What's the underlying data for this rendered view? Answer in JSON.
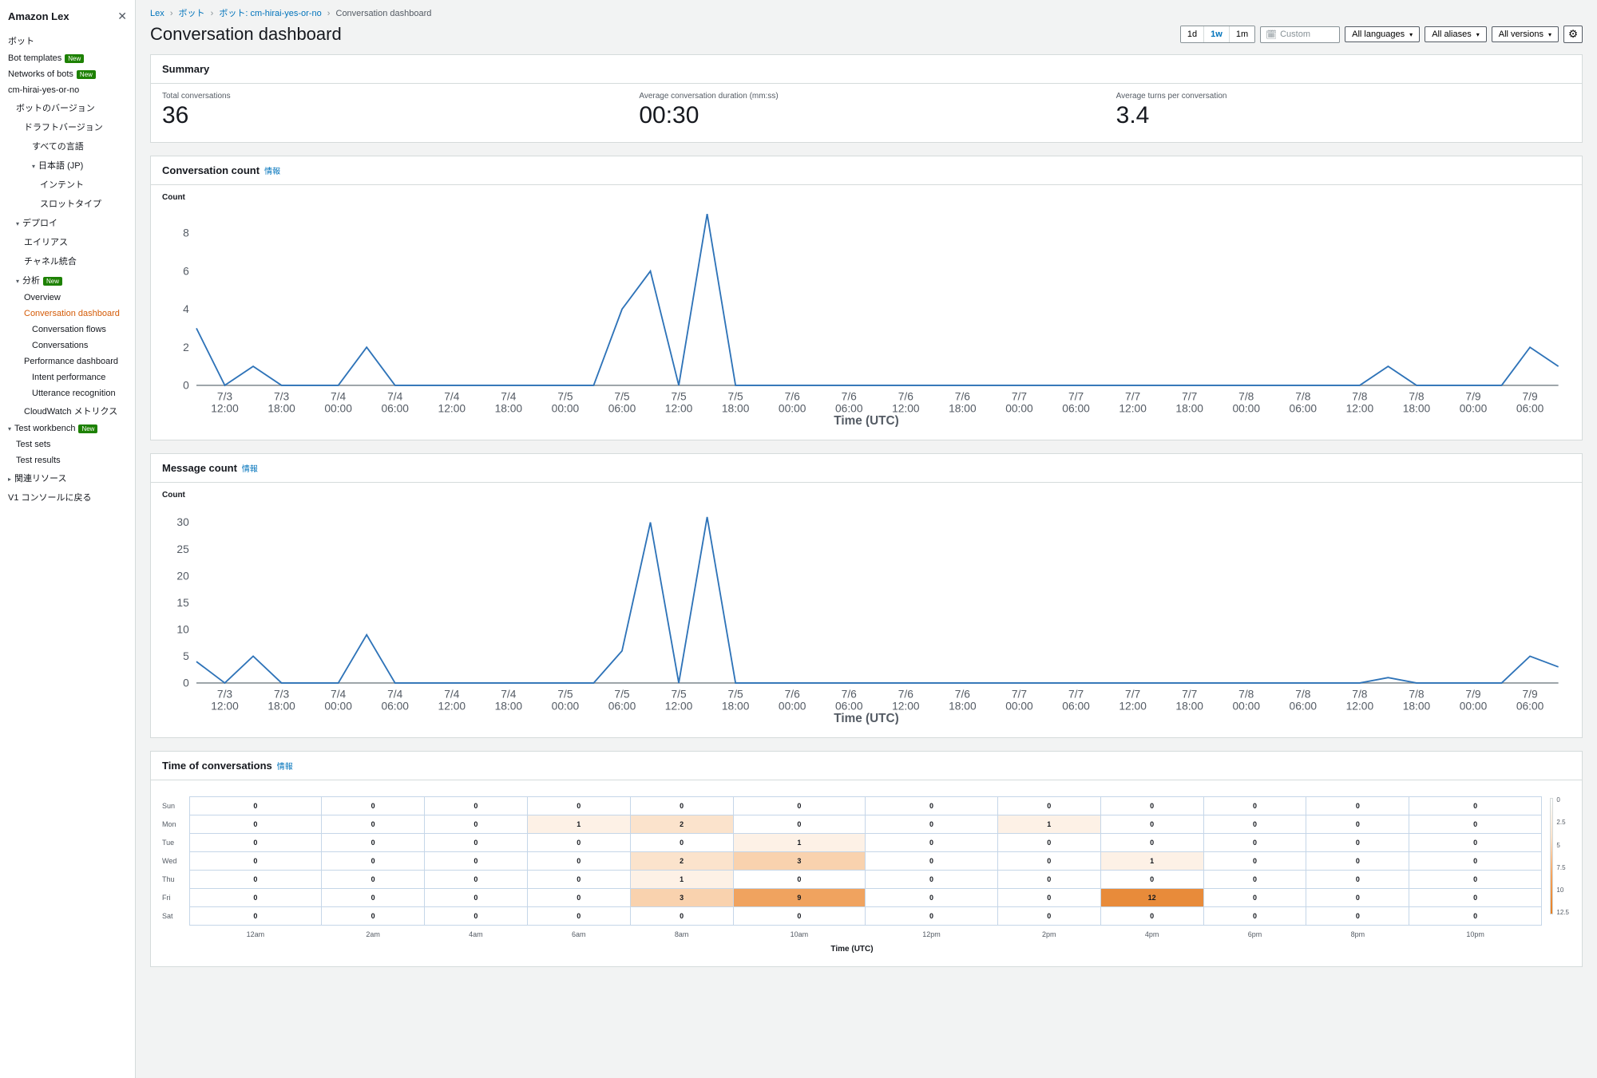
{
  "sidebar": {
    "title": "Amazon Lex",
    "items": [
      {
        "label": "ボット",
        "indent": 0,
        "caret": "",
        "badge": ""
      },
      {
        "label": "Bot templates",
        "indent": 0,
        "caret": "",
        "badge": "New"
      },
      {
        "label": "Networks of bots",
        "indent": 0,
        "caret": "",
        "badge": "New"
      },
      {
        "label": "cm-hirai-yes-or-no",
        "indent": 0,
        "caret": "",
        "badge": ""
      },
      {
        "label": "ボットのバージョン",
        "indent": 1,
        "caret": "",
        "badge": ""
      },
      {
        "label": "ドラフトバージョン",
        "indent": 2,
        "caret": "",
        "badge": ""
      },
      {
        "label": "すべての言語",
        "indent": 3,
        "caret": "",
        "badge": ""
      },
      {
        "label": "日本語 (JP)",
        "indent": 3,
        "caret": "down",
        "badge": ""
      },
      {
        "label": "インテント",
        "indent": 4,
        "caret": "",
        "badge": ""
      },
      {
        "label": "スロットタイプ",
        "indent": 4,
        "caret": "",
        "badge": ""
      },
      {
        "label": "デプロイ",
        "indent": 1,
        "caret": "down",
        "badge": ""
      },
      {
        "label": "エイリアス",
        "indent": 2,
        "caret": "",
        "badge": ""
      },
      {
        "label": "チャネル統合",
        "indent": 2,
        "caret": "",
        "badge": ""
      },
      {
        "label": "分析",
        "indent": 1,
        "caret": "down",
        "badge": "New"
      },
      {
        "label": "Overview",
        "indent": 2,
        "caret": "",
        "badge": ""
      },
      {
        "label": "Conversation dashboard",
        "indent": 2,
        "caret": "",
        "badge": "",
        "active": true
      },
      {
        "label": "Conversation flows",
        "indent": 3,
        "caret": "",
        "badge": ""
      },
      {
        "label": "Conversations",
        "indent": 3,
        "caret": "",
        "badge": ""
      },
      {
        "label": "Performance dashboard",
        "indent": 2,
        "caret": "",
        "badge": ""
      },
      {
        "label": "Intent performance",
        "indent": 3,
        "caret": "",
        "badge": ""
      },
      {
        "label": "Utterance recognition",
        "indent": 3,
        "caret": "",
        "badge": ""
      },
      {
        "label": "CloudWatch メトリクス",
        "indent": 2,
        "caret": "",
        "badge": ""
      },
      {
        "label": "Test workbench",
        "indent": 0,
        "caret": "down",
        "badge": "New"
      },
      {
        "label": "Test sets",
        "indent": 1,
        "caret": "",
        "badge": ""
      },
      {
        "label": "Test results",
        "indent": 1,
        "caret": "",
        "badge": ""
      },
      {
        "label": "関連リソース",
        "indent": 0,
        "caret": "right",
        "badge": ""
      },
      {
        "label": "V1 コンソールに戻る",
        "indent": 0,
        "caret": "",
        "badge": ""
      }
    ]
  },
  "breadcrumb": {
    "parts": [
      "Lex",
      "ボット",
      "ボット: cm-hirai-yes-or-no",
      "Conversation dashboard"
    ]
  },
  "page_title": "Conversation dashboard",
  "toolbar": {
    "range": {
      "options": [
        "1d",
        "1w",
        "1m"
      ],
      "active": "1w"
    },
    "date_placeholder": "Custom",
    "dropdowns": [
      "All languages",
      "All aliases",
      "All versions"
    ]
  },
  "summary": {
    "title": "Summary",
    "items": [
      {
        "label": "Total conversations",
        "value": "36"
      },
      {
        "label": "Average conversation duration (mm:ss)",
        "value": "00:30"
      },
      {
        "label": "Average turns per conversation",
        "value": "3.4"
      }
    ]
  },
  "chart_data": [
    {
      "type": "line",
      "panel_title": "Conversation count",
      "info": "情報",
      "sublabel": "Count",
      "ylabel": "",
      "xlabel": "Time (UTC)",
      "ylim": [
        0,
        9
      ],
      "yticks": [
        0,
        2,
        4,
        6,
        8
      ],
      "x_labels": [
        "7/3\n12:00",
        "7/3\n18:00",
        "7/4\n00:00",
        "7/4\n06:00",
        "7/4\n12:00",
        "7/4\n18:00",
        "7/5\n00:00",
        "7/5\n06:00",
        "7/5\n12:00",
        "7/5\n18:00",
        "7/6\n00:00",
        "7/6\n06:00",
        "7/6\n12:00",
        "7/6\n18:00",
        "7/7\n00:00",
        "7/7\n06:00",
        "7/7\n12:00",
        "7/7\n18:00",
        "7/8\n00:00",
        "7/8\n06:00",
        "7/8\n12:00",
        "7/8\n18:00",
        "7/9\n00:00",
        "7/9\n06:00"
      ],
      "values": [
        3,
        0,
        1,
        0,
        0,
        0,
        2,
        0,
        0,
        0,
        0,
        0,
        0,
        0,
        0,
        4,
        6,
        0,
        9,
        0,
        0,
        0,
        0,
        0,
        0,
        0,
        0,
        0,
        0,
        0,
        0,
        0,
        0,
        0,
        0,
        0,
        0,
        0,
        0,
        0,
        0,
        0,
        1,
        0,
        0,
        0,
        0,
        2,
        1
      ]
    },
    {
      "type": "line",
      "panel_title": "Message count",
      "info": "情報",
      "sublabel": "Count",
      "ylabel": "",
      "xlabel": "Time (UTC)",
      "ylim": [
        0,
        32
      ],
      "yticks": [
        0,
        5,
        10,
        15,
        20,
        25,
        30
      ],
      "x_labels": [
        "7/3\n12:00",
        "7/3\n18:00",
        "7/4\n00:00",
        "7/4\n06:00",
        "7/4\n12:00",
        "7/4\n18:00",
        "7/5\n00:00",
        "7/5\n06:00",
        "7/5\n12:00",
        "7/5\n18:00",
        "7/6\n00:00",
        "7/6\n06:00",
        "7/6\n12:00",
        "7/6\n18:00",
        "7/7\n00:00",
        "7/7\n06:00",
        "7/7\n12:00",
        "7/7\n18:00",
        "7/8\n00:00",
        "7/8\n06:00",
        "7/8\n12:00",
        "7/8\n18:00",
        "7/9\n00:00",
        "7/9\n06:00"
      ],
      "values": [
        4,
        0,
        5,
        0,
        0,
        0,
        9,
        0,
        0,
        0,
        0,
        0,
        0,
        0,
        0,
        6,
        30,
        0,
        31,
        0,
        0,
        0,
        0,
        0,
        0,
        0,
        0,
        0,
        0,
        0,
        0,
        0,
        0,
        0,
        0,
        0,
        0,
        0,
        0,
        0,
        0,
        0,
        1,
        0,
        0,
        0,
        0,
        5,
        3
      ]
    },
    {
      "type": "heatmap",
      "panel_title": "Time of conversations",
      "info": "情報",
      "xlabel": "Time (UTC)",
      "rows": [
        "Sun",
        "Mon",
        "Tue",
        "Wed",
        "Thu",
        "Fri",
        "Sat"
      ],
      "cols": [
        "12am",
        "2am",
        "4am",
        "6am",
        "8am",
        "10am",
        "12pm",
        "2pm",
        "4pm",
        "6pm",
        "8pm",
        "10pm"
      ],
      "values": [
        [
          0,
          0,
          0,
          0,
          0,
          0,
          0,
          0,
          0,
          0,
          0,
          0
        ],
        [
          0,
          0,
          0,
          1,
          2,
          0,
          0,
          1,
          0,
          0,
          0,
          0
        ],
        [
          0,
          0,
          0,
          0,
          0,
          1,
          0,
          0,
          0,
          0,
          0,
          0
        ],
        [
          0,
          0,
          0,
          0,
          2,
          3,
          0,
          0,
          1,
          0,
          0,
          0
        ],
        [
          0,
          0,
          0,
          0,
          1,
          0,
          0,
          0,
          0,
          0,
          0,
          0
        ],
        [
          0,
          0,
          0,
          0,
          3,
          9,
          0,
          0,
          12,
          0,
          0,
          0
        ],
        [
          0,
          0,
          0,
          0,
          0,
          0,
          0,
          0,
          0,
          0,
          0,
          0
        ]
      ],
      "legend_ticks": [
        "0",
        "2.5",
        "5",
        "7.5",
        "10",
        "12.5"
      ]
    }
  ]
}
